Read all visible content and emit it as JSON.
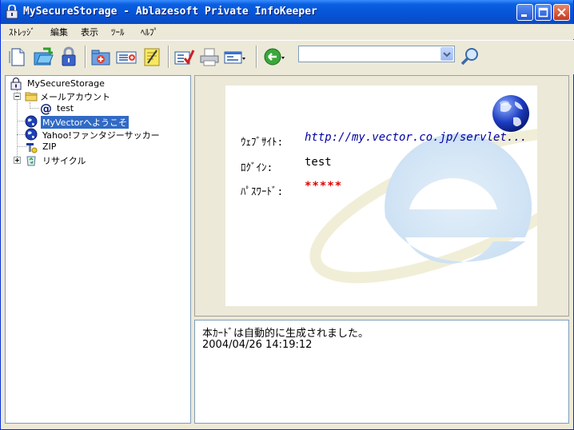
{
  "window": {
    "title": "MySecureStorage - Ablazesoft Private InfoKeeper"
  },
  "menu": [
    {
      "label": "ｽﾄﾚｯｼﾞ"
    },
    {
      "label": "編集"
    },
    {
      "label": "表示"
    },
    {
      "label": "ﾂｰﾙ"
    },
    {
      "label": "ﾍﾙﾌﾟ"
    }
  ],
  "toolbar": {
    "icons": [
      "new-icon",
      "open-folder-icon",
      "lock-icon",
      "new-folder-icon",
      "new-card-icon",
      "memo-icon",
      "checklist-icon",
      "print-icon",
      "view-icon",
      "back-icon",
      "search-icon"
    ],
    "search": {
      "value": ""
    }
  },
  "tree": {
    "root": "MySecureStorage",
    "items": [
      {
        "label": "メールアカウント",
        "icon": "folder-icon",
        "expanded": true
      },
      {
        "label": "test",
        "icon": "at-icon"
      },
      {
        "label": "MyVectorへようこそ",
        "icon": "globe-icon",
        "selected": true
      },
      {
        "label": "Yahoo!ファンタジーサッカー",
        "icon": "globe-icon"
      },
      {
        "label": "ZIP",
        "icon": "key-icon"
      },
      {
        "label": "リサイクル",
        "icon": "recycle-icon",
        "expanded": false
      }
    ]
  },
  "card": {
    "fields": [
      {
        "label": "ｳｪﾌﾞｻｲﾄ:",
        "value": "http://my.vector.co.jp/servlet..."
      },
      {
        "label": "ﾛｸﾞｲﾝ:",
        "value": "test"
      },
      {
        "label": "ﾊﾟｽﾜｰﾄﾞ:",
        "value": "*****"
      }
    ]
  },
  "memo": {
    "line1": "本ｶｰﾄﾞは自動的に生成されました。",
    "line2": "2004/04/26  14:19:12"
  },
  "colors": {
    "titlebar": "#0653d6",
    "selection": "#316ac5",
    "url": "#0000a0",
    "password": "#e00000"
  }
}
